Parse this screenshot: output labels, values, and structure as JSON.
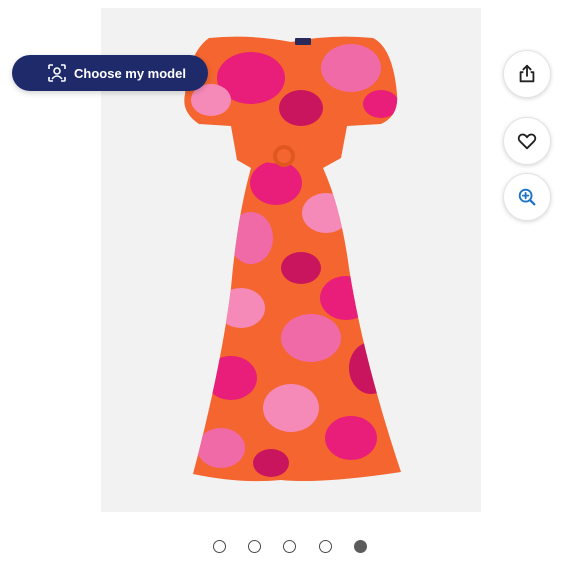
{
  "choose_model": {
    "label": "Choose my model",
    "icon": "person-scan-icon"
  },
  "actions": [
    {
      "name": "share",
      "icon": "share-icon"
    },
    {
      "name": "favorite",
      "icon": "heart-icon"
    },
    {
      "name": "zoom",
      "icon": "zoom-in-icon"
    }
  ],
  "carousel": {
    "total_images": 5,
    "active_index": 5
  },
  "colors": {
    "pill_background": "#1f2a6b",
    "zoom_icon": "#1a73c8",
    "dress_orange": "#f4652f",
    "dress_pink": "#e81e7a"
  }
}
